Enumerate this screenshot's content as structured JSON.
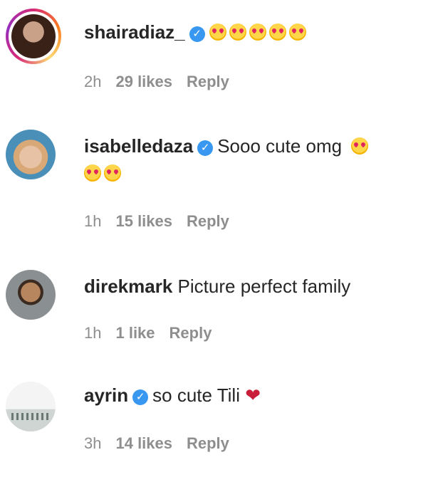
{
  "comments": [
    {
      "username": "shairadiaz_",
      "verified": true,
      "text": "",
      "emoji_count": 5,
      "time": "2h",
      "likes": "29 likes",
      "reply": "Reply"
    },
    {
      "username": "isabelledaza",
      "verified": true,
      "text": "Sooo cute omg",
      "time": "1h",
      "likes": "15 likes",
      "reply": "Reply"
    },
    {
      "username": "direkmark",
      "verified": false,
      "text": "Picture perfect family",
      "time": "1h",
      "likes": "1 like",
      "reply": "Reply"
    },
    {
      "username": "ayrin",
      "verified": true,
      "text": "so cute Tili",
      "time": "3h",
      "likes": "14 likes",
      "reply": "Reply"
    }
  ],
  "icons": {
    "verified": "verified-badge-icon",
    "emoji": "heart-eyes-emoji-icon",
    "heart": "red-heart-icon"
  },
  "colors": {
    "verified_blue": "#3897f0",
    "meta_gray": "#8e8e8e",
    "heart_red": "#c81e3a"
  }
}
